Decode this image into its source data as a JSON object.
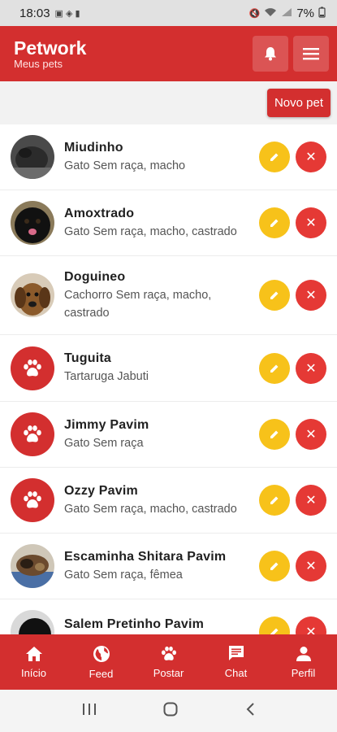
{
  "status_bar": {
    "time": "18:03",
    "battery": "7%"
  },
  "app": {
    "title": "Petwork",
    "subtitle": "Meus pets"
  },
  "toolbar": {
    "new_pet_label": "Novo pet"
  },
  "pets": [
    {
      "name": "Miudinho",
      "description": "Gato Sem raça, macho",
      "avatar": "photo"
    },
    {
      "name": "Amoxtrado",
      "description": "Gato Sem raça, macho, castrado",
      "avatar": "photo"
    },
    {
      "name": "Doguineo",
      "description": "Cachorro Sem raça, macho, castrado",
      "avatar": "photo"
    },
    {
      "name": "Tuguita",
      "description": "Tartaruga Jabuti",
      "avatar": "paw-icon"
    },
    {
      "name": "Jimmy Pavim",
      "description": "Gato Sem raça",
      "avatar": "paw-icon"
    },
    {
      "name": "Ozzy Pavim",
      "description": "Gato Sem raça, macho, castrado",
      "avatar": "paw-icon"
    },
    {
      "name": "Escaminha Shitara Pavim",
      "description": "Gato Sem raça, fêmea",
      "avatar": "photo"
    },
    {
      "name": "Salem Pretinho Pavim",
      "description": "",
      "avatar": "photo"
    }
  ],
  "bottom_nav": [
    {
      "label": "Início",
      "icon": "home-icon"
    },
    {
      "label": "Feed",
      "icon": "globe-icon"
    },
    {
      "label": "Postar",
      "icon": "paw-icon"
    },
    {
      "label": "Chat",
      "icon": "chat-icon"
    },
    {
      "label": "Perfil",
      "icon": "person-icon"
    }
  ],
  "colors": {
    "primary": "#d32f2f",
    "edit": "#f7c21a",
    "delete": "#e53935"
  }
}
